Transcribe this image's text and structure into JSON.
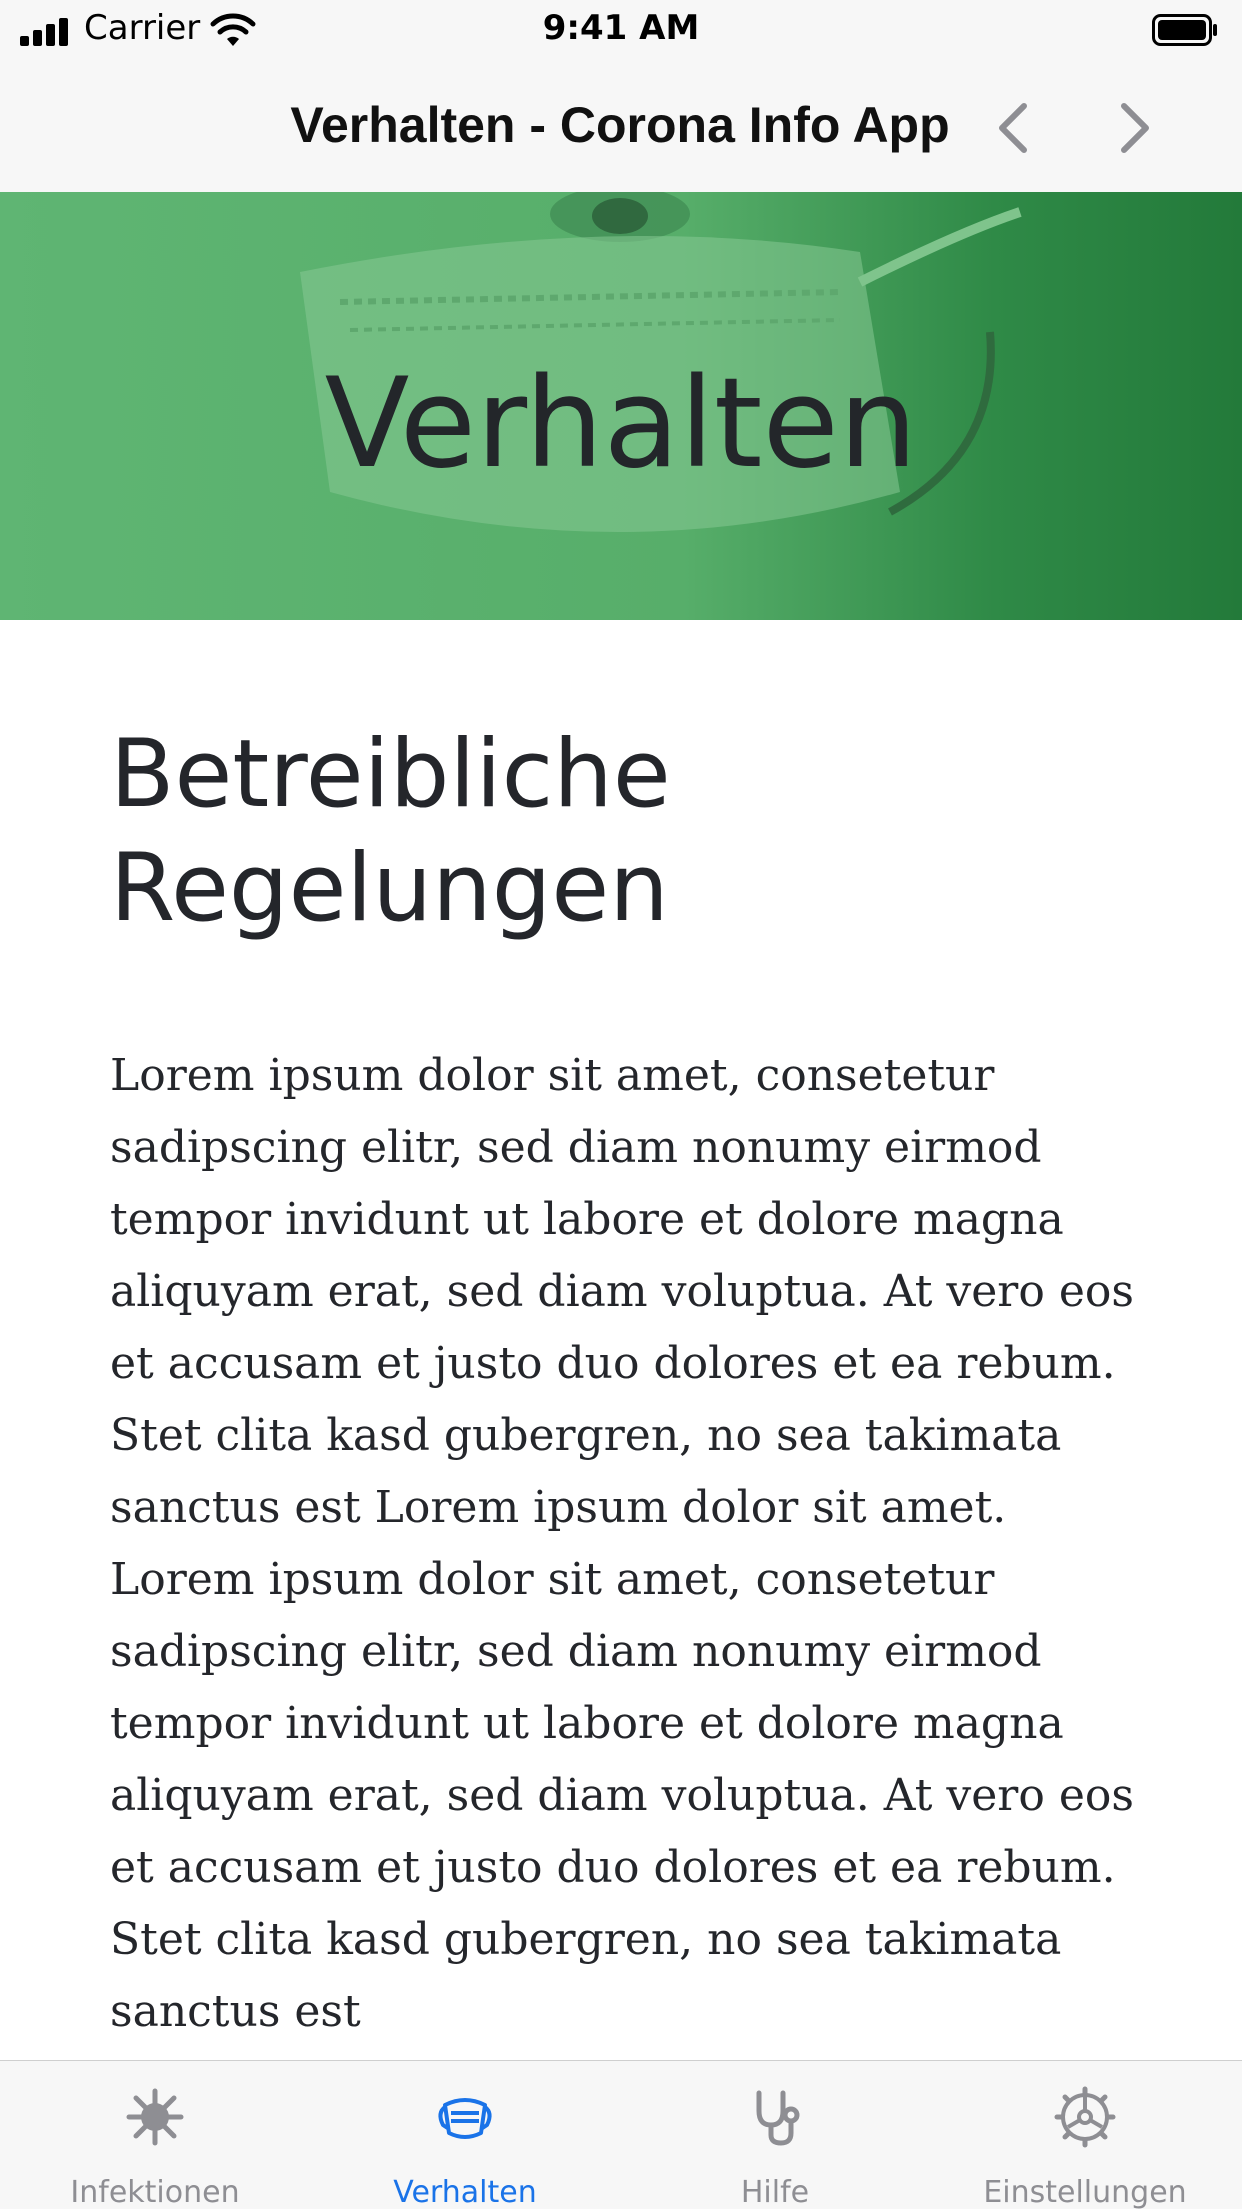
{
  "status_bar": {
    "carrier": "Carrier",
    "time": "9:41 AM",
    "icons": [
      "signal-icon",
      "wifi-icon",
      "battery-icon"
    ]
  },
  "nav_bar": {
    "title": "Verhalten - Corona Info App",
    "icons": [
      "back-chevron-icon",
      "forward-chevron-icon"
    ]
  },
  "hero": {
    "title": "Verhalten",
    "overlay_color": "#5fb573"
  },
  "content": {
    "heading": "Betreibliche Regelungen",
    "body": "Lorem ipsum dolor sit amet, consetetur sadipscing elitr, sed diam nonumy eirmod tempor invidunt ut labore et dolore magna aliquyam erat, sed diam voluptua. At vero eos et accusam et justo duo dolores et ea rebum. Stet clita kasd gubergren, no sea takimata sanctus est Lorem ipsum dolor sit amet. Lorem ipsum dolor sit amet, consetetur sadipscing elitr, sed diam nonumy eirmod tempor invidunt ut labore et dolore magna aliquyam erat, sed diam voluptua. At vero eos et accusam et justo duo dolores et ea rebum. Stet clita kasd gubergren, no sea takimata sanctus est"
  },
  "tab_bar": {
    "active_color": "#1a73e8",
    "inactive_color": "#8e8e93",
    "tabs": [
      {
        "label": "Infektionen",
        "icon": "virus-icon",
        "active": false
      },
      {
        "label": "Verhalten",
        "icon": "face-mask-icon",
        "active": true
      },
      {
        "label": "Hilfe",
        "icon": "stethoscope-icon",
        "active": false
      },
      {
        "label": "Einstellungen",
        "icon": "gear-icon",
        "active": false
      }
    ]
  }
}
